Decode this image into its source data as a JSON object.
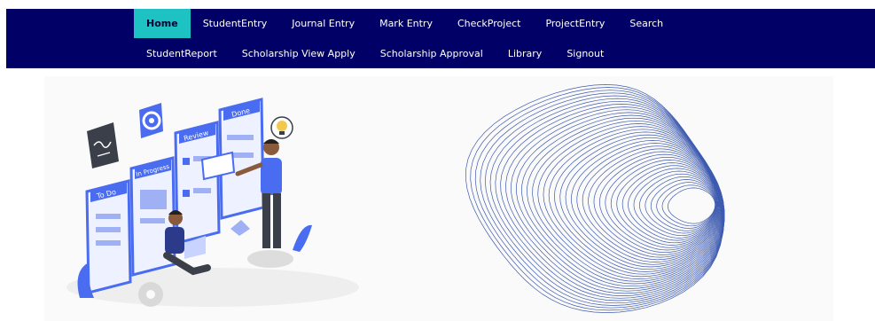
{
  "nav": {
    "row1": [
      {
        "label": "Home",
        "active": true
      },
      {
        "label": "StudentEntry"
      },
      {
        "label": "Journal Entry"
      },
      {
        "label": "Mark Entry"
      },
      {
        "label": "CheckProject"
      },
      {
        "label": "ProjectEntry"
      },
      {
        "label": "Search"
      }
    ],
    "row2": [
      {
        "label": "StudentReport"
      },
      {
        "label": "Scholarship View Apply"
      },
      {
        "label": "Scholarship Approval"
      },
      {
        "label": "Library"
      },
      {
        "label": "Signout"
      }
    ]
  },
  "illustration": {
    "cards": [
      "To Do",
      "In Progress",
      "Review",
      "Done"
    ]
  },
  "colors": {
    "nav_bg": "#000066",
    "active_bg": "#1fc2c2",
    "accent_blue": "#4a6cf0",
    "spiral_blue": "#2a4aa8"
  }
}
